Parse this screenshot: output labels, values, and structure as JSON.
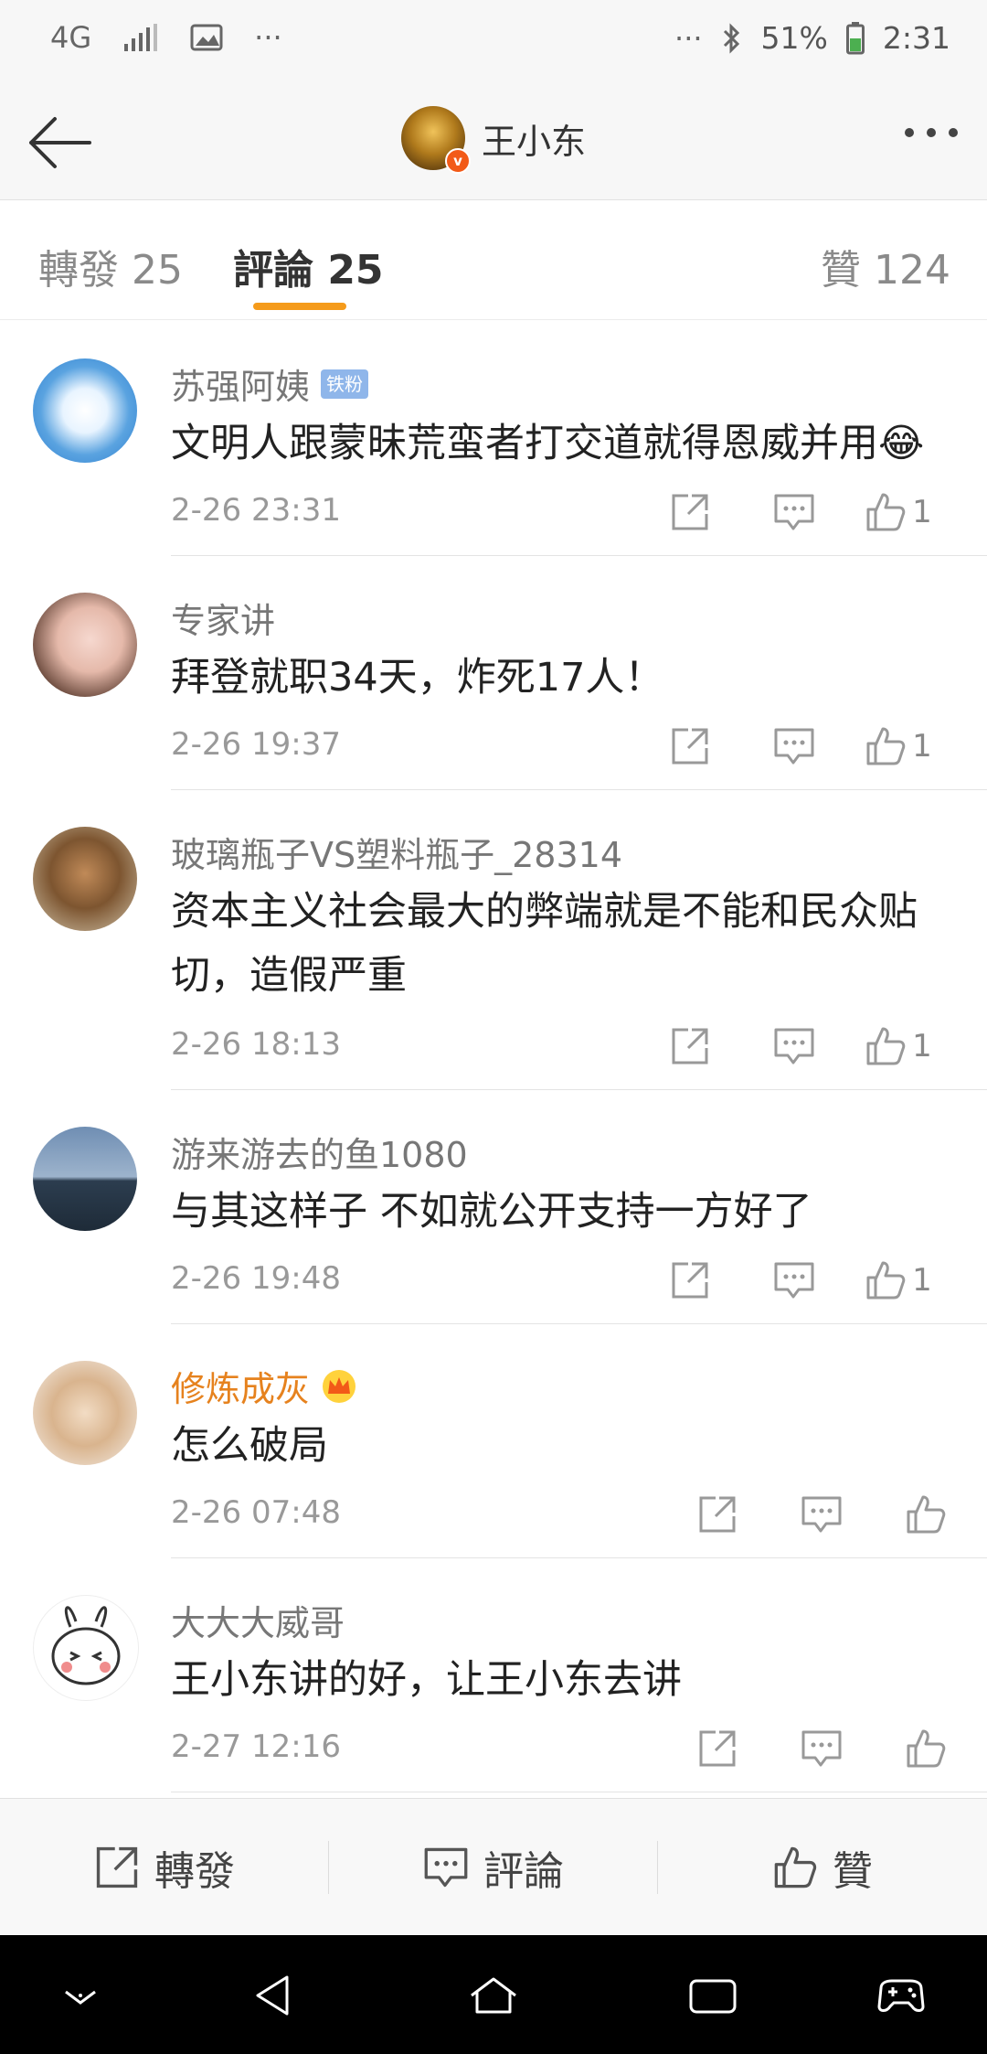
{
  "status_bar": {
    "network": "4G",
    "signal": "signal-bars-icon",
    "gallery": "image-icon",
    "dots_left": "···",
    "dots_right": "···",
    "bluetooth": "bluetooth-icon",
    "battery": "51%",
    "time": "2:31"
  },
  "header": {
    "title": "王小东"
  },
  "tabs": [
    {
      "label": "轉發 25"
    },
    {
      "label": "評論 25"
    },
    {
      "label": "贊 124"
    }
  ],
  "comments": [
    {
      "name": "苏强阿姨",
      "badge": "铁粉",
      "text": "文明人跟蒙昧荒蛮者打交道就得恩威并用😂",
      "time": "2-26 23:31",
      "likes": "1"
    },
    {
      "name": "专家讲",
      "text": "拜登就职34天，炸死17人！",
      "time": "2-26 19:37",
      "likes": "1"
    },
    {
      "name": "玻璃瓶子VS塑料瓶子_28314",
      "text": "资本主义社会最大的弊端就是不能和民众贴切，造假严重",
      "time": "2-26 18:13",
      "likes": "1"
    },
    {
      "name": "游来游去的鱼1080",
      "text": "与其这样子 不如就公开支持一方好了",
      "time": "2-26 19:48",
      "likes": "1"
    },
    {
      "name": "修炼成灰",
      "text": "怎么破局",
      "time": "2-26 07:48",
      "likes": ""
    },
    {
      "name": "大大大威哥",
      "text": "王小东讲的好，让王小东去讲",
      "time": "2-27 12:16",
      "likes": ""
    }
  ],
  "bottom_bar": {
    "repost": "轉發",
    "comment": "評論",
    "like": "贊"
  },
  "colors": {
    "accent": "#f59b1b",
    "fan_badge": "#8fb6ea",
    "vip_name": "#e6821e"
  }
}
